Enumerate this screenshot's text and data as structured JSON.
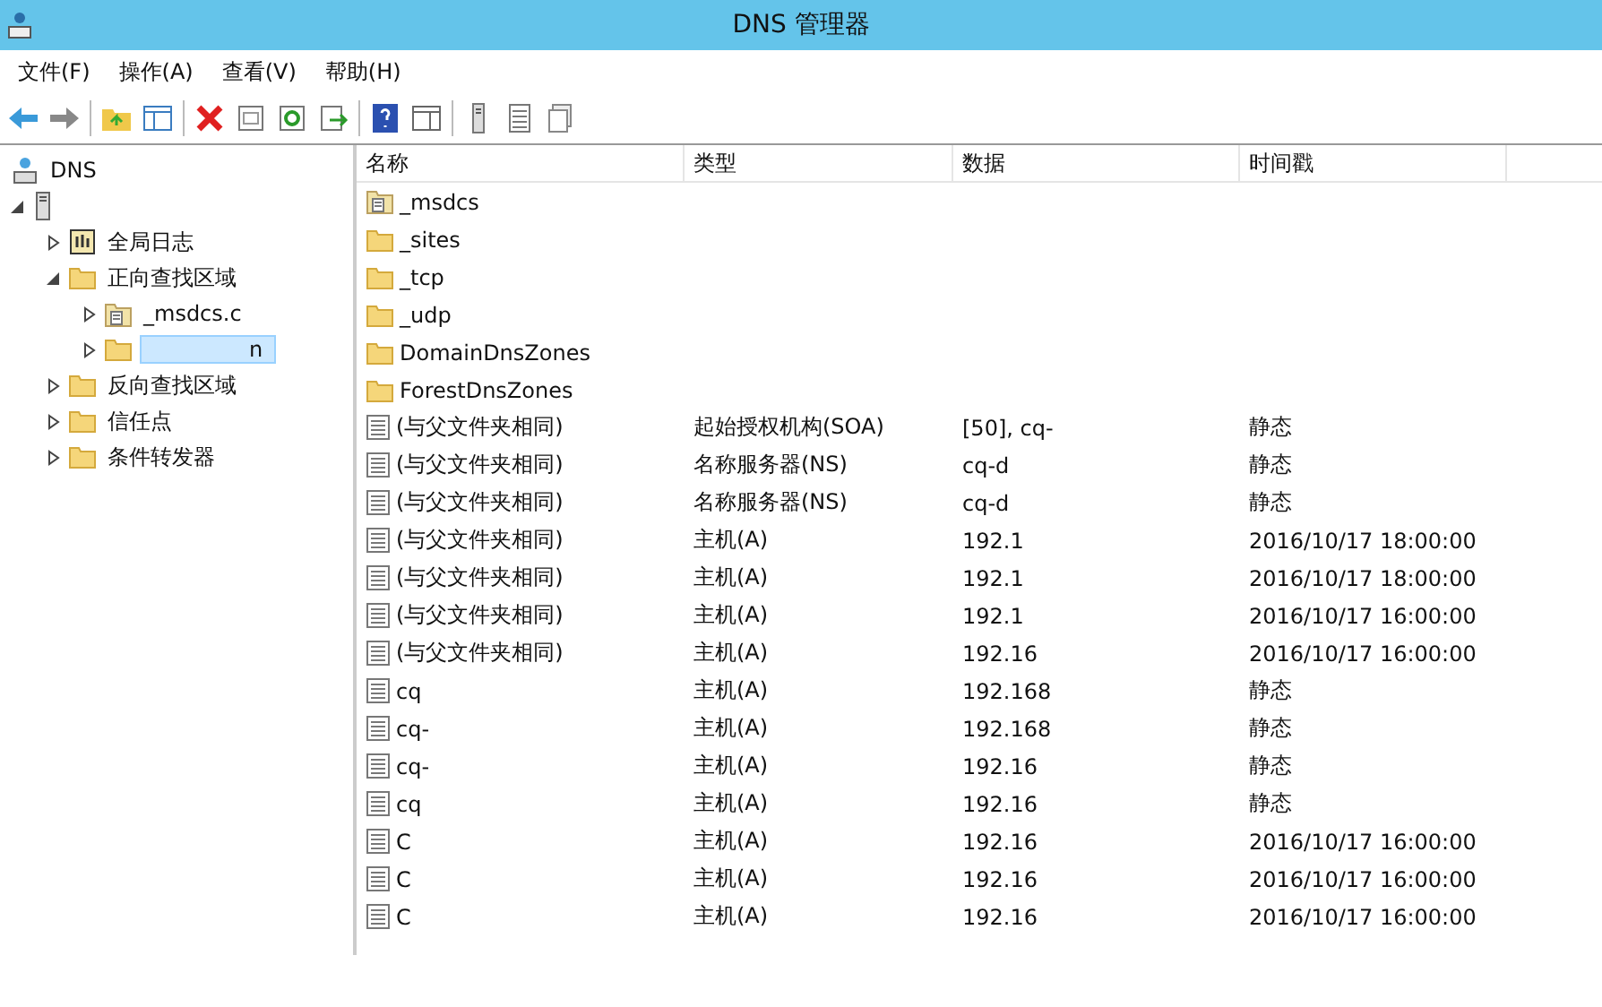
{
  "window": {
    "title": "DNS 管理器"
  },
  "menu": [
    "文件(F)",
    "操作(A)",
    "查看(V)",
    "帮助(H)"
  ],
  "toolbar": [
    {
      "kind": "back"
    },
    {
      "kind": "forward"
    },
    {
      "kind": "sep"
    },
    {
      "kind": "folder-up"
    },
    {
      "kind": "pane"
    },
    {
      "kind": "sep"
    },
    {
      "kind": "delete"
    },
    {
      "kind": "props"
    },
    {
      "kind": "refresh"
    },
    {
      "kind": "export"
    },
    {
      "kind": "sep"
    },
    {
      "kind": "help"
    },
    {
      "kind": "pane2"
    },
    {
      "kind": "sep"
    },
    {
      "kind": "server"
    },
    {
      "kind": "list"
    },
    {
      "kind": "copy"
    }
  ],
  "tree": [
    {
      "label": "DNS",
      "kind": "dns",
      "selected": false,
      "children": [
        {
          "kind": "server",
          "expanded": true,
          "children": [
            {
              "label": "全局日志",
              "kind": "log",
              "expanded": false,
              "selected": false
            },
            {
              "label": "正向查找区域",
              "kind": "folder",
              "expanded": true,
              "selected": false,
              "children": [
                {
                  "label": "_msdcs.c",
                  "kind": "zone",
                  "expanded": false,
                  "selected": false
                },
                {
                  "label": "n",
                  "kind": "folder",
                  "expanded": false,
                  "selected": true
                }
              ]
            },
            {
              "label": "反向查找区域",
              "kind": "folder",
              "expanded": false,
              "selected": false
            },
            {
              "label": "信任点",
              "kind": "folder",
              "expanded": false,
              "selected": false
            },
            {
              "label": "条件转发器",
              "kind": "folder",
              "expanded": false,
              "selected": false
            }
          ]
        }
      ]
    }
  ],
  "table": {
    "columns": [
      "名称",
      "类型",
      "数据",
      "时间戳"
    ],
    "rows": [
      {
        "kind": "zone",
        "name": "_msdcs"
      },
      {
        "kind": "folder",
        "name": "_sites"
      },
      {
        "kind": "folder",
        "name": "_tcp"
      },
      {
        "kind": "folder",
        "name": "_udp"
      },
      {
        "kind": "folder",
        "name": "DomainDnsZones"
      },
      {
        "kind": "folder",
        "name": "ForestDnsZones"
      },
      {
        "kind": "record",
        "name": "(与父文件夹相同)",
        "type": "起始授权机构(SOA)",
        "data": "[50], cq-",
        "timestamp": "静态"
      },
      {
        "kind": "record",
        "name": "(与父文件夹相同)",
        "type": "名称服务器(NS)",
        "data": "cq-d",
        "timestamp": "静态"
      },
      {
        "kind": "record",
        "name": "(与父文件夹相同)",
        "type": "名称服务器(NS)",
        "data": "cq-d",
        "timestamp": "静态"
      },
      {
        "kind": "record",
        "name": "(与父文件夹相同)",
        "type": "主机(A)",
        "data": "192.1",
        "timestamp": "2016/10/17 18:00:00"
      },
      {
        "kind": "record",
        "name": "(与父文件夹相同)",
        "type": "主机(A)",
        "data": "192.1",
        "timestamp": "2016/10/17 18:00:00"
      },
      {
        "kind": "record",
        "name": "(与父文件夹相同)",
        "type": "主机(A)",
        "data": "192.1",
        "timestamp": "2016/10/17 16:00:00"
      },
      {
        "kind": "record",
        "name": "(与父文件夹相同)",
        "type": "主机(A)",
        "data": "192.16",
        "timestamp": "2016/10/17 16:00:00"
      },
      {
        "kind": "record",
        "name": "cq",
        "type": "主机(A)",
        "data": "192.168",
        "timestamp": "静态"
      },
      {
        "kind": "record",
        "name": "cq-",
        "type": "主机(A)",
        "data": "192.168",
        "timestamp": "静态"
      },
      {
        "kind": "record",
        "name": "cq-",
        "type": "主机(A)",
        "data": "192.16",
        "timestamp": "静态"
      },
      {
        "kind": "record",
        "name": "cq",
        "type": "主机(A)",
        "data": "192.16",
        "timestamp": "静态"
      },
      {
        "kind": "record",
        "name": "C",
        "type": "主机(A)",
        "data": "192.16",
        "timestamp": "2016/10/17 16:00:00"
      },
      {
        "kind": "record",
        "name": "C",
        "type": "主机(A)",
        "data": "192.16",
        "timestamp": "2016/10/17 16:00:00"
      },
      {
        "kind": "record",
        "name": "C",
        "type": "主机(A)",
        "data": "192.16",
        "timestamp": "2016/10/17 16:00:00"
      }
    ]
  }
}
